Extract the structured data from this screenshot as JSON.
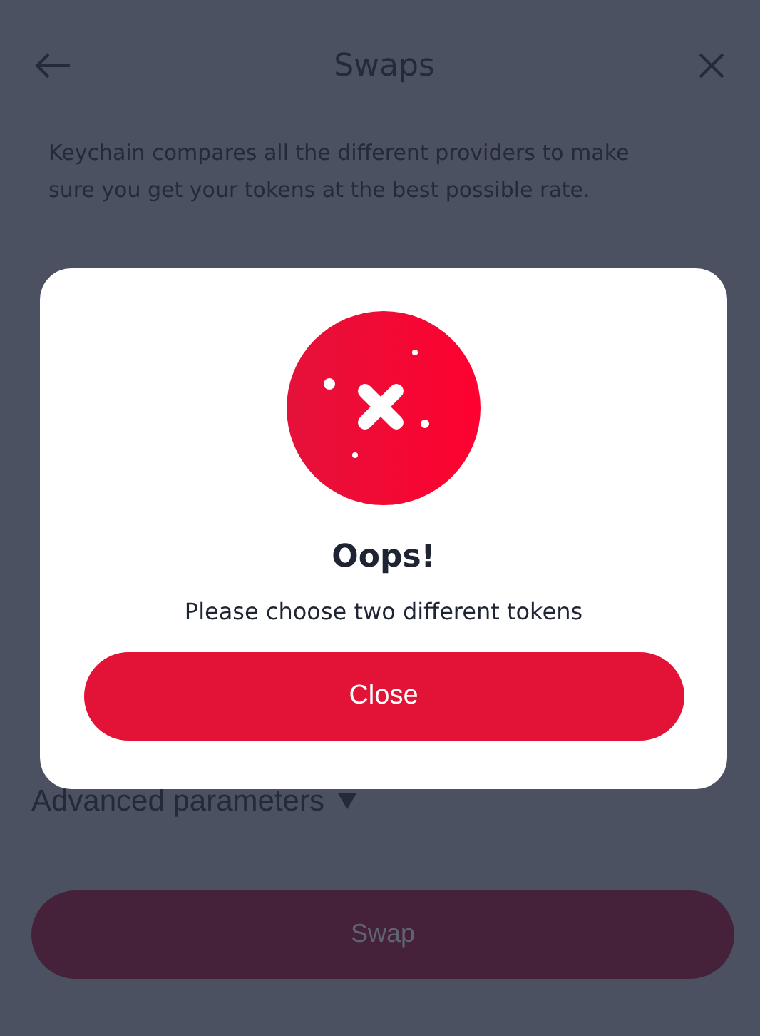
{
  "header": {
    "title": "Swaps"
  },
  "description": "Keychain compares all the different providers to make sure you get your tokens at the best possible rate.",
  "advanced": {
    "label": "Advanced parameters",
    "expanded": false
  },
  "swap_button": {
    "label": "Swap"
  },
  "dialog": {
    "title": "Oops!",
    "message": "Please choose two different tokens",
    "button": "Close"
  }
}
